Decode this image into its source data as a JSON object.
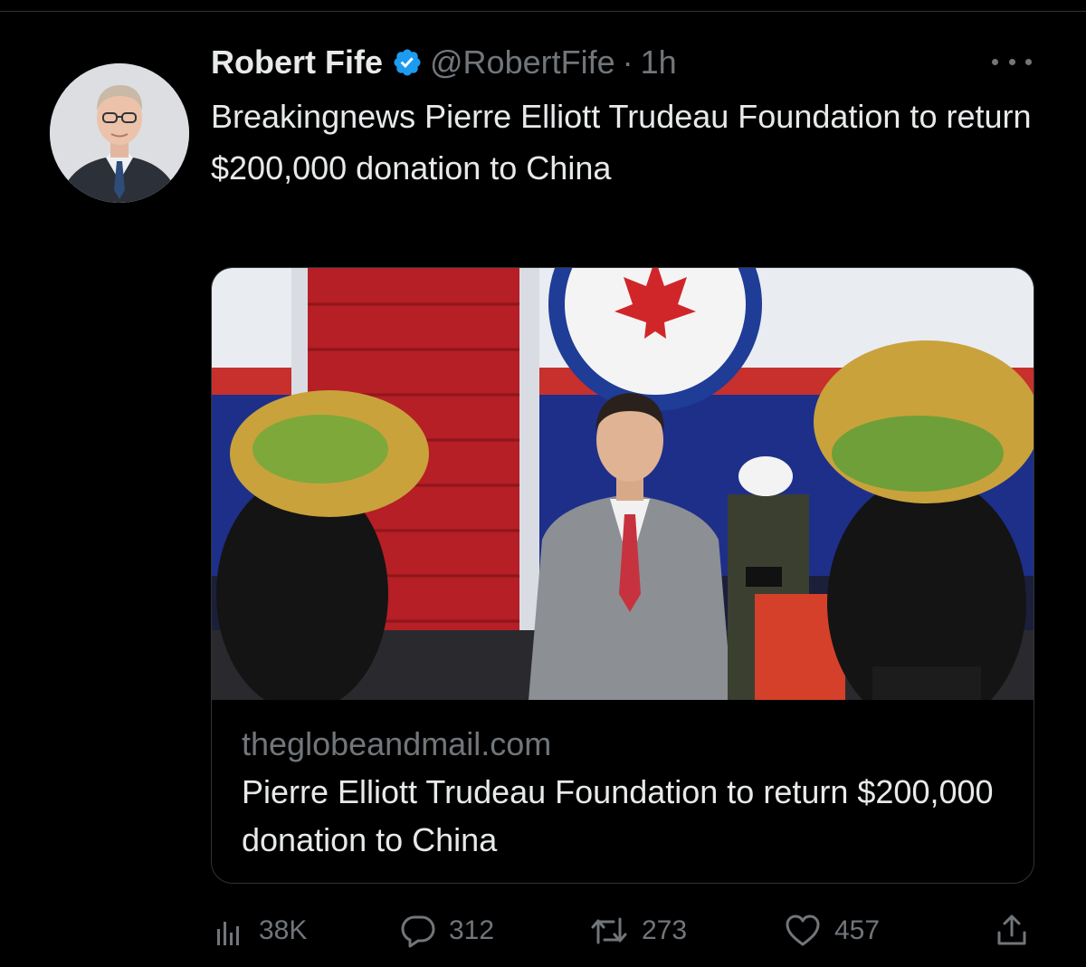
{
  "tweet": {
    "author_name": "Robert Fife",
    "handle": "@RobertFife",
    "separator": "·",
    "time": "1h",
    "text": "Breakingnews Pierre Elliott Trudeau Foundation to return $200,000 donation to China"
  },
  "link_card": {
    "domain": "theglobeandmail.com",
    "title": "Pierre Elliott Trudeau Foundation to return $200,000 donation to China"
  },
  "actions": {
    "views": "38K",
    "replies": "312",
    "retweets": "273",
    "likes": "457"
  },
  "icons": {
    "verified": "verified-badge-icon",
    "more": "more-options-icon",
    "views": "analytics-icon",
    "reply": "reply-icon",
    "retweet": "retweet-icon",
    "like": "heart-icon",
    "share": "share-icon"
  },
  "colors": {
    "background": "#000000",
    "primary_text": "#e7e9ea",
    "secondary_text": "#71767b",
    "verified_blue": "#1d9bf0",
    "border": "#2f3336"
  }
}
